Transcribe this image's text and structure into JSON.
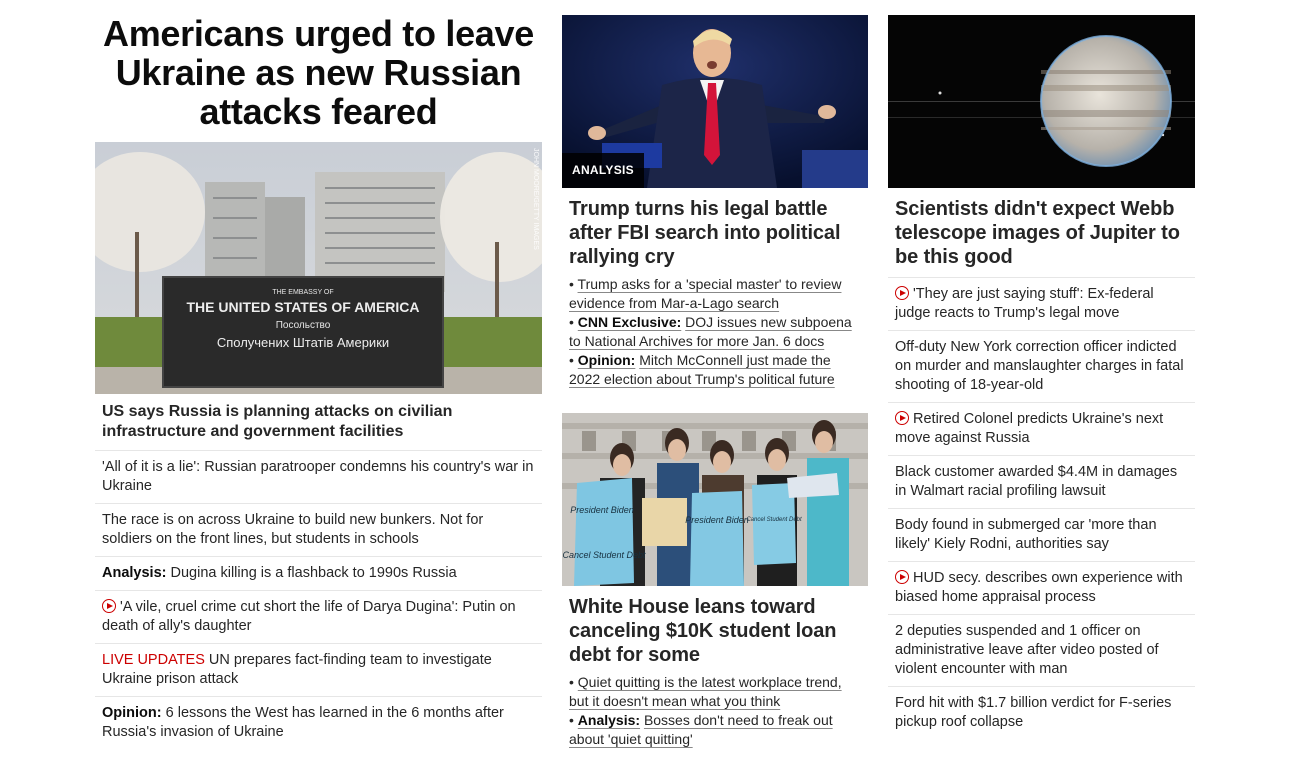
{
  "col1": {
    "headline": "Americans urged to leave Ukraine as new Russian attacks feared",
    "image": {
      "alt": "Embassy of the United States sign in Kyiv",
      "credit": "JOHN MOORE/GETTY IMAGES",
      "sign_line1": "THE EMBASSY OF",
      "sign_line2": "THE UNITED STATES OF AMERICA",
      "sign_line3": "Посольство",
      "sign_line4": "Сполучених Штатів Америки"
    },
    "lead": "US says Russia is planning attacks on civilian infrastructure and government facilities",
    "items": [
      {
        "label": "",
        "text": "'All of it is a lie': Russian paratrooper condemns his country's war in Ukraine",
        "video": false
      },
      {
        "label": "",
        "text": "The race is on across Ukraine to build new bunkers. Not for soldiers on the front lines, but students in schools",
        "video": false
      },
      {
        "label": "Analysis:",
        "text": "Dugina killing is a flashback to 1990s Russia",
        "video": false
      },
      {
        "label": "",
        "text": "'A vile, cruel crime cut short the life of Darya Dugina': Putin on death of ally's daughter",
        "video": true
      },
      {
        "live": "LIVE UPDATES",
        "text": "UN prepares fact-finding team to investigate Ukraine prison attack",
        "video": false
      },
      {
        "label": "Opinion:",
        "text": "6 lessons the West has learned in the 6 months after Russia's invasion of Ukraine",
        "video": false
      }
    ]
  },
  "col2": {
    "story1": {
      "badge": "ANALYSIS",
      "title": "Trump turns his legal battle after FBI search into political rallying cry",
      "bullets": [
        {
          "label": "",
          "text": "Trump asks for a 'special master' to review evidence from Mar-a-Lago search"
        },
        {
          "label": "CNN Exclusive:",
          "text": "DOJ issues new subpoena to National Archives for more Jan. 6 docs"
        },
        {
          "label": "Opinion:",
          "text": "Mitch McConnell just made the 2022 election about Trump's political future"
        }
      ]
    },
    "story2": {
      "title": "White House leans toward canceling $10K student loan debt for some",
      "bullets": [
        {
          "label": "",
          "text": "Quiet quitting is the latest workplace trend, but it doesn't mean what you think"
        },
        {
          "label": "Analysis:",
          "text": "Bosses don't need to freak out about 'quiet quitting'"
        }
      ],
      "signs": [
        "President Biden",
        "Cancel Student Debt",
        "President Biden",
        "Cancel Student Debt"
      ]
    }
  },
  "col3": {
    "title": "Scientists didn't expect Webb telescope images of Jupiter to be this good",
    "items": [
      {
        "text": "'They are just saying stuff': Ex-federal judge reacts to Trump's legal move",
        "video": true
      },
      {
        "text": "Off-duty New York correction officer indicted on murder and manslaughter charges in fatal shooting of 18-year-old",
        "video": false
      },
      {
        "text": "Retired Colonel predicts Ukraine's next move against Russia",
        "video": true
      },
      {
        "text": "Black customer awarded $4.4M in damages in Walmart racial profiling lawsuit",
        "video": false
      },
      {
        "text": "Body found in submerged car 'more than likely' Kiely Rodni, authorities say",
        "video": false
      },
      {
        "text": "HUD secy. describes own experience with biased home appraisal process",
        "video": true
      },
      {
        "text": "2 deputies suspended and 1 officer on administrative leave after video posted of violent encounter with man",
        "video": false
      },
      {
        "text": "Ford hit with $1.7 billion verdict for F-series pickup roof collapse",
        "video": false
      }
    ]
  },
  "colors": {
    "accent_red": "#cc0000",
    "text": "#262626",
    "divider": "#e6e6e6"
  }
}
